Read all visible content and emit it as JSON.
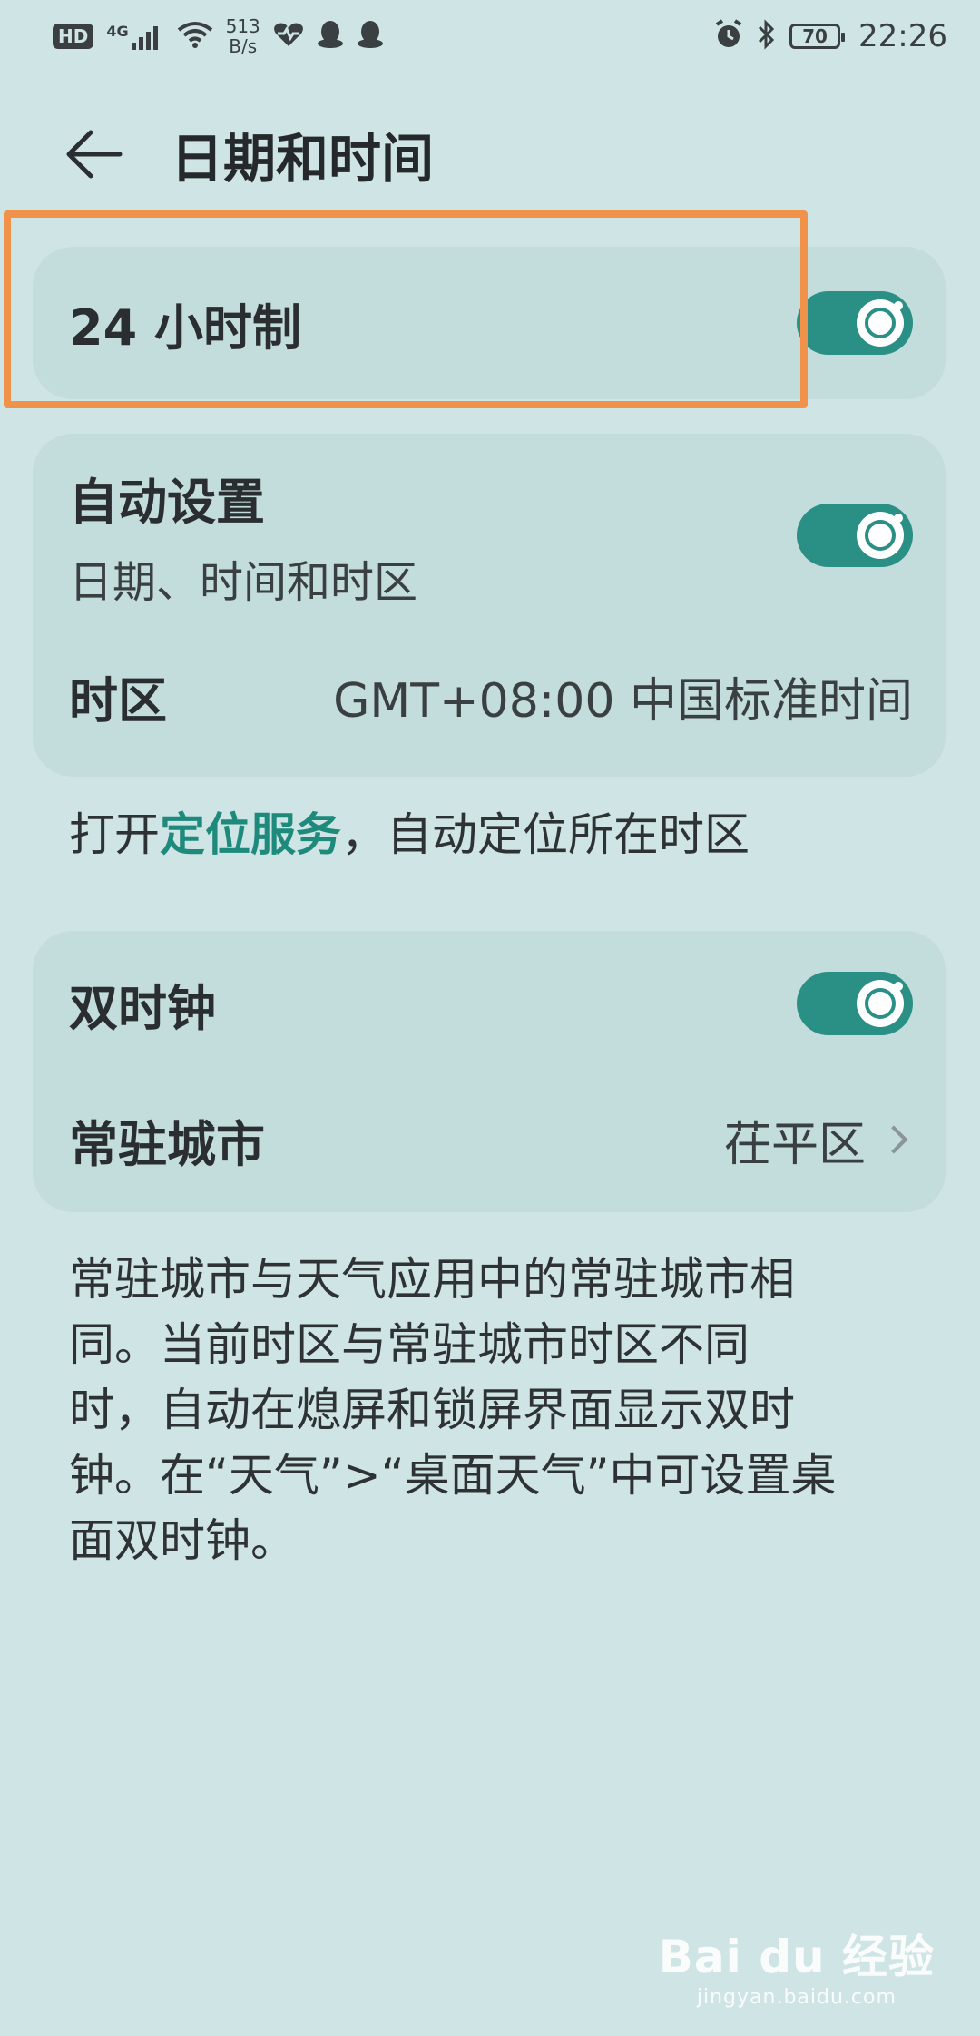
{
  "status_bar": {
    "hd": "HD",
    "signal": "4G",
    "net_speed_value": "513",
    "net_speed_unit": "B/s",
    "battery": "70",
    "time": "22:26"
  },
  "header": {
    "title": "日期和时间"
  },
  "settings": {
    "hour24": {
      "label": "24 小时制",
      "enabled": true
    },
    "auto": {
      "label": "自动设置",
      "sublabel": "日期、时间和时区",
      "enabled": true
    },
    "timezone": {
      "label": "时区",
      "value": "GMT+08:00 中国标准时间"
    },
    "dual_clock": {
      "label": "双时钟",
      "enabled": true
    },
    "home_city": {
      "label": "常驻城市",
      "value": "茌平区"
    }
  },
  "hint": {
    "prefix": "打开",
    "link": "定位服务",
    "suffix": "，自动定位所在时区"
  },
  "description": {
    "lines": [
      "常驻城市与天气应用中的常驻城市相",
      "同。当前时区与常驻城市时区不同",
      "时，自动在熄屏和锁屏界面显示双时",
      "钟。在“天气”>“桌面天气”中可设置桌",
      "面双时钟。"
    ]
  },
  "watermark": {
    "main": "Bai du 经验",
    "sub": "jingyan.baidu.com"
  },
  "colors": {
    "background": "#cfe5e5",
    "card": "#c3dcdc",
    "accent": "#2a8f84",
    "highlight": "#f0924a"
  }
}
